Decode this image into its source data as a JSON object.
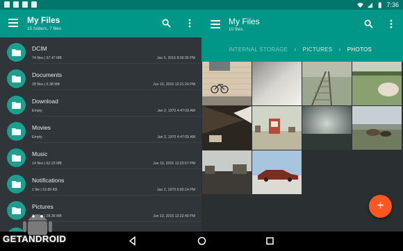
{
  "status_bar": {
    "time": "7:36",
    "icons": [
      "wifi-icon",
      "signal-icon",
      "battery-icon"
    ]
  },
  "left_pane": {
    "app_title": "My Files",
    "subtitle": "15 folders, 7 files",
    "folders": [
      {
        "name": "DCIM",
        "meta": "74 files | 57.47 MB",
        "date": "Jan 5, 2015 8:39:36 PM"
      },
      {
        "name": "Documents",
        "meta": "28 files | 6.38 MB",
        "date": "Jun 10, 2015 12:21:24 PM"
      },
      {
        "name": "Download",
        "meta": "Empty",
        "date": "Jan 2, 1970 4:47:09 AM"
      },
      {
        "name": "Movies",
        "meta": "Empty",
        "date": "Jan 2, 1970 4:47:09 AM"
      },
      {
        "name": "Music",
        "meta": "14 files | 62.23 MB",
        "date": "Jun 10, 2015 12:23:57 PM"
      },
      {
        "name": "Notifications",
        "meta": "1 file | 52.89 KB",
        "date": "Jan 2, 1970 6:00:14 PM"
      },
      {
        "name": "Pictures",
        "meta": "34 files | 28.36 MB",
        "date": "Jun 10, 2015 12:22:49 PM"
      }
    ]
  },
  "right_pane": {
    "app_title": "My Files",
    "subtitle": "10 files",
    "breadcrumbs": [
      "INTERNAL STORAGE",
      "PICTURES",
      "PHOTOS"
    ],
    "photos": [
      "bicycle-wall-photo",
      "grey-sky-photo",
      "railway-track-photo",
      "pumpkin-field-photo",
      "dark-interior-photo",
      "beach-hut-photo",
      "dark-landscape-photo",
      "cows-field-photo",
      "buildings-sky-photo",
      "red-car-photo"
    ],
    "fab_label": "+"
  },
  "watermark": {
    "text": "GETANDROID"
  },
  "colors": {
    "primary": "#009688",
    "primary_dark": "#00766d",
    "accent": "#ff5722",
    "background": "#2f3538"
  }
}
